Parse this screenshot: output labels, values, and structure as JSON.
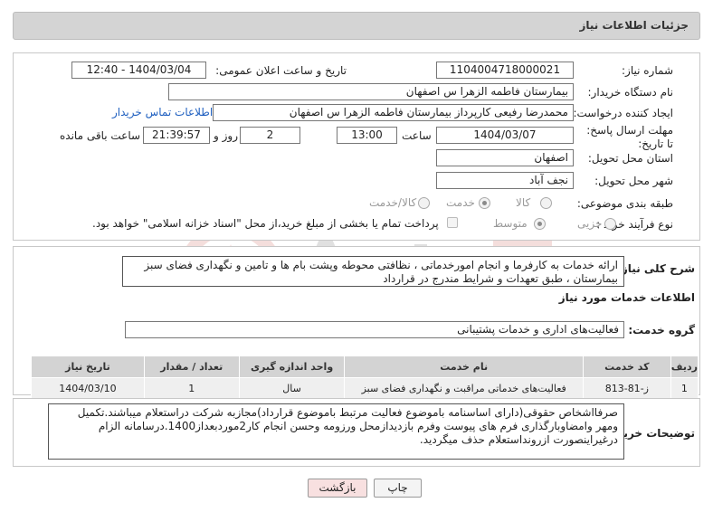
{
  "header": {
    "title": "جزئیات اطلاعات نیاز"
  },
  "fields": {
    "need_number_label": "شماره نیاز:",
    "need_number": "1104004718000021",
    "announce_label": "تاریخ و ساعت اعلان عمومی:",
    "announce_value": "1404/03/04 - 12:40",
    "buyer_org_label": "نام دستگاه خریدار:",
    "buyer_org": "بیمارستان فاطمه الزهرا س  اصفهان",
    "requester_label": "ایجاد کننده درخواست:",
    "requester": "محمدرضا رفیعی کارپرداز بیمارستان فاطمه الزهرا س  اصفهان",
    "contact_link": "اطلاعات تماس خریدار",
    "deadline_label": "مهلت ارسال پاسخ: تا تاریخ:",
    "deadline_date": "1404/03/07",
    "time_label": "ساعت",
    "deadline_time": "13:00",
    "days_value": "2",
    "days_label": "روز و",
    "remaining_time": "21:39:57",
    "remaining_label": "ساعت باقی مانده",
    "province_label": "استان محل تحویل:",
    "province": "اصفهان",
    "city_label": "شهر محل تحویل:",
    "city": "نجف آباد",
    "category_label": "طبقه بندی موضوعی:",
    "category_options": [
      "کالا",
      "خدمت",
      "کالا/خدمت"
    ],
    "process_label": "نوع فرآیند خرید :",
    "process_options": [
      "جزیی",
      "متوسط"
    ],
    "payment_note": "پرداخت تمام یا بخشی از مبلغ خرید،از محل \"اسناد خزانه اسلامی\" خواهد بود."
  },
  "summary": {
    "label": "شرح کلی نیاز:",
    "text": "ارائه خدمات به کارفرما و انجام امورخدماتی ، نظافتی  محوطه وپشت بام ها  و تامین و  نگهداری  فضای سبز بیمارستان ، طبق تعهدات و شرایط مندرج در قرارداد"
  },
  "services_section": {
    "title": "اطلاعات خدمات مورد نیاز",
    "group_label": "گروه خدمت:",
    "group_value": "فعالیت‌های اداری و خدمات پشتیبانی"
  },
  "table": {
    "headers": [
      "ردیف",
      "کد خدمت",
      "نام خدمت",
      "واحد اندازه گیری",
      "تعداد / مقدار",
      "تاریخ نیاز"
    ],
    "rows": [
      [
        "1",
        "ز-81-813",
        "فعالیت‌های خدماتی مراقبت و نگهداری فضای سبز",
        "سال",
        "1",
        "1404/03/10"
      ]
    ]
  },
  "buyer_notes": {
    "label": "توضیحات خریدار:",
    "text": "صرفااشخاص حقوقی(دارای اساسنامه باموضوع فعالیت مرتبط باموضوع قرارداد)مجازبه شرکت دراستعلام میباشند.تکمیل ومهر وامضاوبارگذاری فرم های پیوست وفرم بازدیدازمحل ورزومه وحسن انجام کار2موردبعداز1400.درسامانه الزام درغیراینصورت ازروند‌استعلام حذف میگردید."
  },
  "buttons": {
    "print": "چاپ",
    "back": "بازگشت"
  },
  "colors": {
    "back_button": "#f8e0e0",
    "link": "#2060c0",
    "table_header": "#d3d3d3"
  }
}
